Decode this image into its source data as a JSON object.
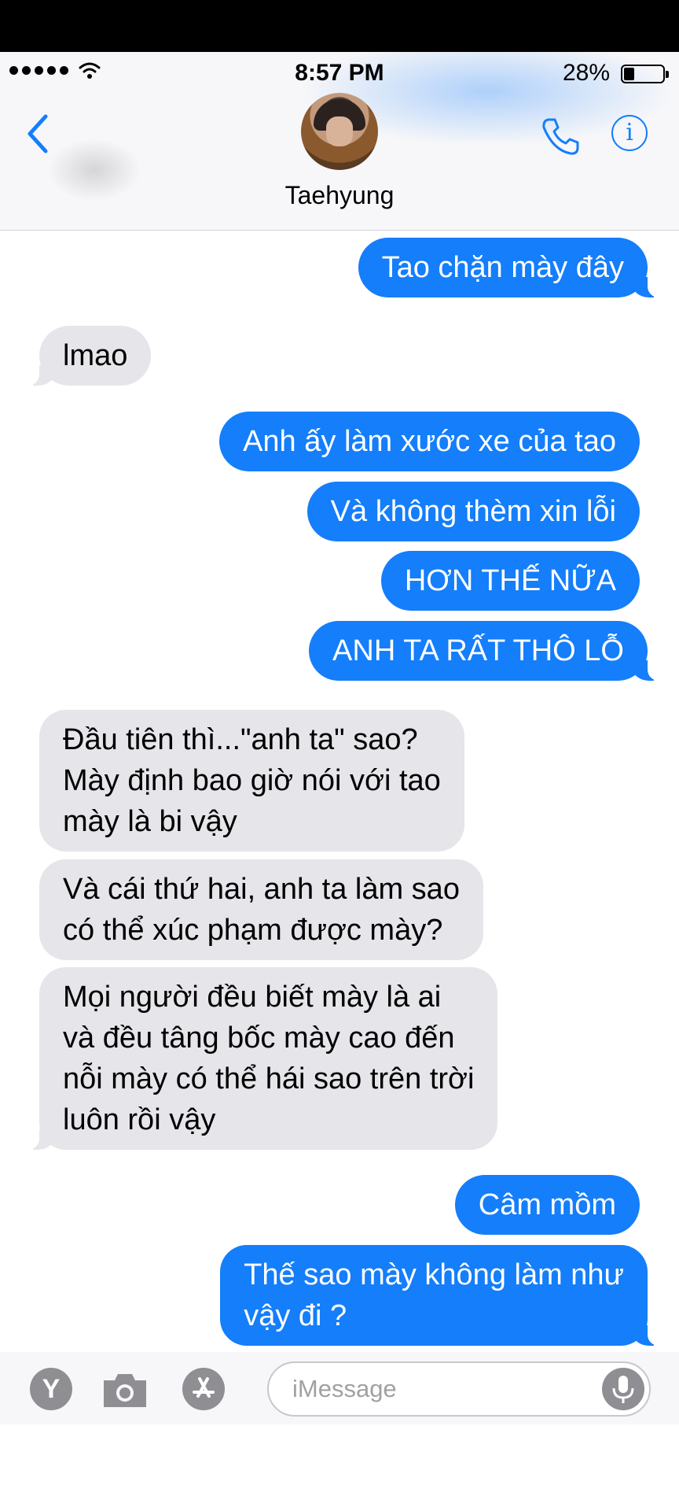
{
  "status_bar": {
    "time": "8:57 PM",
    "battery": "28%"
  },
  "header": {
    "contact_name": "Taehyung"
  },
  "messages": [
    {
      "from": "me",
      "text": "Tao chặn mày đây"
    },
    {
      "from": "them",
      "text": "lmao"
    },
    {
      "from": "me",
      "text": "Anh ấy làm xước xe của tao"
    },
    {
      "from": "me",
      "text": "Và không thèm xin lỗi"
    },
    {
      "from": "me",
      "text": "HƠN THẾ NỮA"
    },
    {
      "from": "me",
      "text": "ANH TA RẤT THÔ LỖ"
    },
    {
      "from": "them",
      "text": "Đầu tiên thì...\"anh ta\" sao?\nMày định bao giờ nói với tao\nmày là bi vậy"
    },
    {
      "from": "them",
      "text": "Và cái thứ hai, anh ta làm sao\ncó thể xúc phạm được mày?"
    },
    {
      "from": "them",
      "text": "Mọi người đều biết mày là ai\nvà đều tâng bốc mày cao đến\nnỗi mày có thể hái sao trên trời\nluôn rồi vậy"
    },
    {
      "from": "me",
      "text": "Câm mồm"
    },
    {
      "from": "me",
      "text": "Thế sao mày không làm như\nvậy đi ?"
    }
  ],
  "input_bar": {
    "placeholder": "iMessage",
    "games_button": "Y"
  },
  "icons": {
    "back": "chevron-left-icon",
    "phone": "phone-icon",
    "info": "info-icon",
    "camera": "camera-icon",
    "app_store": "app-store-icon",
    "mic": "microphone-icon"
  },
  "colors": {
    "accent": "#147efb",
    "received_bubble": "#e5e5ea",
    "icon_gray": "#8e8e93"
  }
}
